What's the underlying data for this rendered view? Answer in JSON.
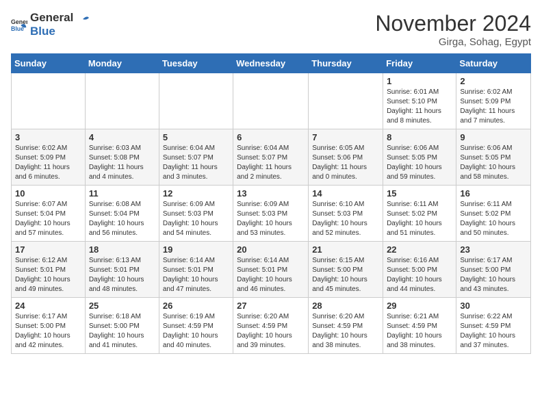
{
  "logo": {
    "general": "General",
    "blue": "Blue"
  },
  "title": "November 2024",
  "location": "Girga, Sohag, Egypt",
  "days_header": [
    "Sunday",
    "Monday",
    "Tuesday",
    "Wednesday",
    "Thursday",
    "Friday",
    "Saturday"
  ],
  "weeks": [
    [
      {
        "day": "",
        "info": ""
      },
      {
        "day": "",
        "info": ""
      },
      {
        "day": "",
        "info": ""
      },
      {
        "day": "",
        "info": ""
      },
      {
        "day": "",
        "info": ""
      },
      {
        "day": "1",
        "info": "Sunrise: 6:01 AM\nSunset: 5:10 PM\nDaylight: 11 hours and 8 minutes."
      },
      {
        "day": "2",
        "info": "Sunrise: 6:02 AM\nSunset: 5:09 PM\nDaylight: 11 hours and 7 minutes."
      }
    ],
    [
      {
        "day": "3",
        "info": "Sunrise: 6:02 AM\nSunset: 5:09 PM\nDaylight: 11 hours and 6 minutes."
      },
      {
        "day": "4",
        "info": "Sunrise: 6:03 AM\nSunset: 5:08 PM\nDaylight: 11 hours and 4 minutes."
      },
      {
        "day": "5",
        "info": "Sunrise: 6:04 AM\nSunset: 5:07 PM\nDaylight: 11 hours and 3 minutes."
      },
      {
        "day": "6",
        "info": "Sunrise: 6:04 AM\nSunset: 5:07 PM\nDaylight: 11 hours and 2 minutes."
      },
      {
        "day": "7",
        "info": "Sunrise: 6:05 AM\nSunset: 5:06 PM\nDaylight: 11 hours and 0 minutes."
      },
      {
        "day": "8",
        "info": "Sunrise: 6:06 AM\nSunset: 5:05 PM\nDaylight: 10 hours and 59 minutes."
      },
      {
        "day": "9",
        "info": "Sunrise: 6:06 AM\nSunset: 5:05 PM\nDaylight: 10 hours and 58 minutes."
      }
    ],
    [
      {
        "day": "10",
        "info": "Sunrise: 6:07 AM\nSunset: 5:04 PM\nDaylight: 10 hours and 57 minutes."
      },
      {
        "day": "11",
        "info": "Sunrise: 6:08 AM\nSunset: 5:04 PM\nDaylight: 10 hours and 56 minutes."
      },
      {
        "day": "12",
        "info": "Sunrise: 6:09 AM\nSunset: 5:03 PM\nDaylight: 10 hours and 54 minutes."
      },
      {
        "day": "13",
        "info": "Sunrise: 6:09 AM\nSunset: 5:03 PM\nDaylight: 10 hours and 53 minutes."
      },
      {
        "day": "14",
        "info": "Sunrise: 6:10 AM\nSunset: 5:03 PM\nDaylight: 10 hours and 52 minutes."
      },
      {
        "day": "15",
        "info": "Sunrise: 6:11 AM\nSunset: 5:02 PM\nDaylight: 10 hours and 51 minutes."
      },
      {
        "day": "16",
        "info": "Sunrise: 6:11 AM\nSunset: 5:02 PM\nDaylight: 10 hours and 50 minutes."
      }
    ],
    [
      {
        "day": "17",
        "info": "Sunrise: 6:12 AM\nSunset: 5:01 PM\nDaylight: 10 hours and 49 minutes."
      },
      {
        "day": "18",
        "info": "Sunrise: 6:13 AM\nSunset: 5:01 PM\nDaylight: 10 hours and 48 minutes."
      },
      {
        "day": "19",
        "info": "Sunrise: 6:14 AM\nSunset: 5:01 PM\nDaylight: 10 hours and 47 minutes."
      },
      {
        "day": "20",
        "info": "Sunrise: 6:14 AM\nSunset: 5:01 PM\nDaylight: 10 hours and 46 minutes."
      },
      {
        "day": "21",
        "info": "Sunrise: 6:15 AM\nSunset: 5:00 PM\nDaylight: 10 hours and 45 minutes."
      },
      {
        "day": "22",
        "info": "Sunrise: 6:16 AM\nSunset: 5:00 PM\nDaylight: 10 hours and 44 minutes."
      },
      {
        "day": "23",
        "info": "Sunrise: 6:17 AM\nSunset: 5:00 PM\nDaylight: 10 hours and 43 minutes."
      }
    ],
    [
      {
        "day": "24",
        "info": "Sunrise: 6:17 AM\nSunset: 5:00 PM\nDaylight: 10 hours and 42 minutes."
      },
      {
        "day": "25",
        "info": "Sunrise: 6:18 AM\nSunset: 5:00 PM\nDaylight: 10 hours and 41 minutes."
      },
      {
        "day": "26",
        "info": "Sunrise: 6:19 AM\nSunset: 4:59 PM\nDaylight: 10 hours and 40 minutes."
      },
      {
        "day": "27",
        "info": "Sunrise: 6:20 AM\nSunset: 4:59 PM\nDaylight: 10 hours and 39 minutes."
      },
      {
        "day": "28",
        "info": "Sunrise: 6:20 AM\nSunset: 4:59 PM\nDaylight: 10 hours and 38 minutes."
      },
      {
        "day": "29",
        "info": "Sunrise: 6:21 AM\nSunset: 4:59 PM\nDaylight: 10 hours and 38 minutes."
      },
      {
        "day": "30",
        "info": "Sunrise: 6:22 AM\nSunset: 4:59 PM\nDaylight: 10 hours and 37 minutes."
      }
    ]
  ]
}
